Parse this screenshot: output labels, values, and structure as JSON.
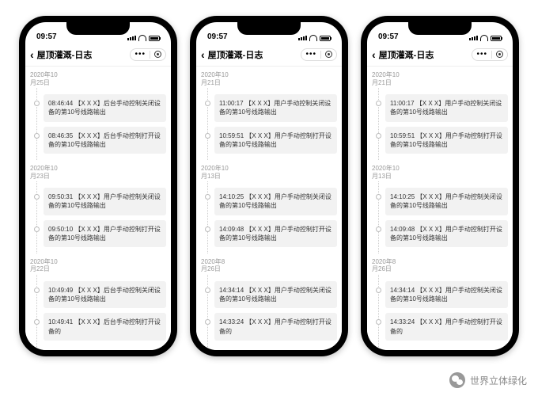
{
  "status_time": "09:57",
  "nav_title": "屋顶灌溉-日志",
  "footer_label": "世界立体绿化",
  "phones": [
    {
      "groups": [
        {
          "date_l1": "2020年10",
          "date_l2": "月25日",
          "entries": [
            {
              "time": "08:46:44",
              "msg": "【X X X】后台手动控制关闭设备的第10号线路输出"
            },
            {
              "time": "08:46:35",
              "msg": "【X X X】后台手动控制打开设备的第10号线路输出"
            }
          ]
        },
        {
          "date_l1": "2020年10",
          "date_l2": "月23日",
          "entries": [
            {
              "time": "09:50:31",
              "msg": "【X X X】用户手动控制关闭设备的第10号线路输出"
            },
            {
              "time": "09:50:10",
              "msg": "【X X X】用户手动控制打开设备的第10号线路输出"
            }
          ]
        },
        {
          "date_l1": "2020年10",
          "date_l2": "月22日",
          "entries": [
            {
              "time": "10:49:49",
              "msg": "【X X X】后台手动控制关闭设备的第10号线路输出"
            },
            {
              "time": "10:49:41",
              "msg": "【X X X】后台手动控制打开设备的"
            }
          ]
        }
      ]
    },
    {
      "groups": [
        {
          "date_l1": "2020年10",
          "date_l2": "月21日",
          "entries": [
            {
              "time": "11:00:17",
              "msg": "【X X X】用户手动控制关闭设备的第10号线路输出"
            },
            {
              "time": "10:59:51",
              "msg": "【X X X】用户手动控制打开设备的第10号线路输出"
            }
          ]
        },
        {
          "date_l1": "2020年10",
          "date_l2": "月13日",
          "entries": [
            {
              "time": "14:10:25",
              "msg": "【X X X】用户手动控制关闭设备的第10号线路输出"
            },
            {
              "time": "14:09:48",
              "msg": "【X X X】用户手动控制打开设备的第10号线路输出"
            }
          ]
        },
        {
          "date_l1": "2020年8",
          "date_l2": "月26日",
          "entries": [
            {
              "time": "14:34:14",
              "msg": "【X X X】用户手动控制关闭设备的第10号线路输出"
            },
            {
              "time": "14:33:24",
              "msg": "【X X X】用户手动控制打开设备的"
            }
          ]
        }
      ]
    },
    {
      "groups": [
        {
          "date_l1": "2020年10",
          "date_l2": "月21日",
          "entries": [
            {
              "time": "11:00:17",
              "msg": "【X X X】用户手动控制关闭设备的第10号线路输出"
            },
            {
              "time": "10:59:51",
              "msg": "【X X X】用户手动控制打开设备的第10号线路输出"
            }
          ]
        },
        {
          "date_l1": "2020年10",
          "date_l2": "月13日",
          "entries": [
            {
              "time": "14:10:25",
              "msg": "【X X X】用户手动控制关闭设备的第10号线路输出"
            },
            {
              "time": "14:09:48",
              "msg": "【X X X】用户手动控制打开设备的第10号线路输出"
            }
          ]
        },
        {
          "date_l1": "2020年8",
          "date_l2": "月26日",
          "entries": [
            {
              "time": "14:34:14",
              "msg": "【X X X】用户手动控制关闭设备的第10号线路输出"
            },
            {
              "time": "14:33:24",
              "msg": "【X X X】用户手动控制打开设备的"
            }
          ]
        }
      ]
    }
  ]
}
